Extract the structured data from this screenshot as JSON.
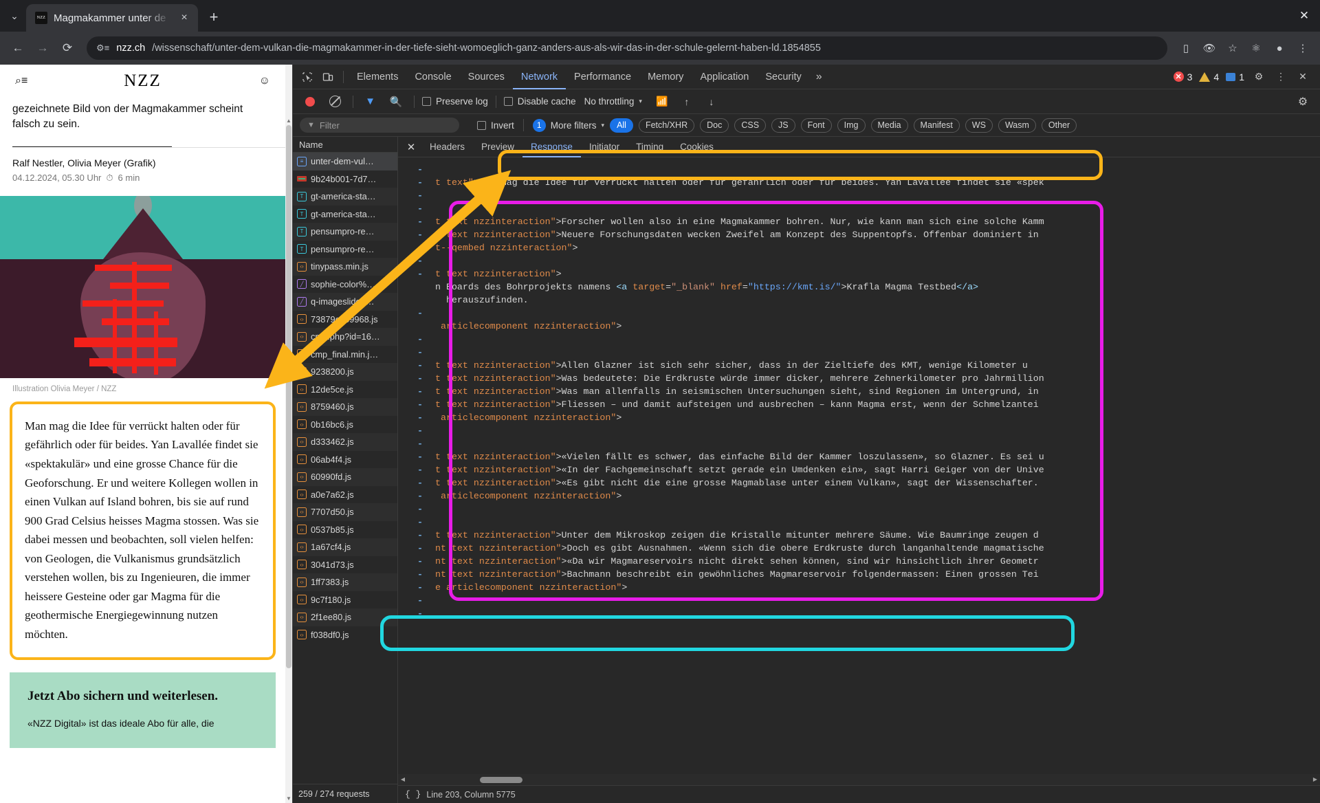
{
  "browser": {
    "tab": {
      "title": "Magmakammer unter de",
      "favicon_text": "NZZ"
    },
    "newtab_label": "+",
    "close_label": "×",
    "window_close": "✕",
    "url_host": "nzz.ch",
    "url_path": "/wissenschaft/unter-dem-vulkan-die-magmakammer-in-der-tiefe-sieht-womoeglich-ganz-anders-aus-als-wir-das-in-der-schule-gelernt-haben-ld.1854855",
    "nav": {
      "back": "←",
      "forward": "→",
      "reload": "⟳"
    },
    "toolbar_icons": [
      "cast-icon",
      "incognito-eye-icon",
      "bookmark-star-icon",
      "extensions-icon",
      "profile-icon",
      "menu-icon"
    ]
  },
  "page": {
    "logo": "NZZ",
    "lede": "gezeichnete Bild von der Magmakammer scheint falsch zu sein.",
    "byline": "Ralf Nestler, Olivia Meyer (Grafik)",
    "date": "04.12.2024, 05.30 Uhr",
    "reading_time": "6 min",
    "illustration_caption": "Illustration Olivia Meyer / NZZ",
    "highlighted_paragraph": "Man mag die Idee für verrückt halten oder für gefährlich oder für beides. Yan Lavallée findet sie «spektakulär» und eine grosse Chance für die Geoforschung. Er und weitere Kollegen wollen in einen Vulkan auf Island bohren, bis sie auf rund 900 Grad Celsius heisses Magma stossen. Was sie dabei messen und beobachten, soll vielen helfen: von Geologen, die Vulkanismus grundsätzlich verstehen wollen, bis zu Ingenieuren, die immer heissere Gesteine oder gar Magma für die geothermische Energiegewinnung nutzen möchten.",
    "abo": {
      "title": "Jetzt Abo sichern und weiterlesen.",
      "body": "«NZZ Digital» ist das ideale Abo für alle, die"
    }
  },
  "devtools": {
    "panels": [
      "Elements",
      "Console",
      "Sources",
      "Network",
      "Performance",
      "Memory",
      "Application",
      "Security"
    ],
    "selected_panel": "Network",
    "more_panels": "»",
    "counters": {
      "errors": "3",
      "warnings": "4",
      "messages": "1"
    },
    "settings_icon": "gear-icon",
    "kebab_icon": "kebab-icon",
    "close_icon": "✕",
    "controls": {
      "preserve_log": "Preserve log",
      "disable_cache": "Disable cache",
      "throttling": "No throttling",
      "caret": "▾"
    },
    "filter": {
      "placeholder": "Filter",
      "invert": "Invert",
      "more_filters": "More filters",
      "more_filters_count": "1",
      "caret": "▾",
      "types": [
        "All",
        "Fetch/XHR",
        "Doc",
        "CSS",
        "JS",
        "Font",
        "Img",
        "Media",
        "Manifest",
        "WS",
        "Wasm",
        "Other"
      ],
      "selected_type": "All"
    },
    "netlist": {
      "column": "Name",
      "status": "259 / 274 requests",
      "rows": [
        {
          "name": "unter-dem-vul…",
          "type": "doc",
          "glyph": "≡",
          "selected": true
        },
        {
          "name": "9b24b001-7d7…",
          "type": "media",
          "glyph": ""
        },
        {
          "name": "gt-america-sta…",
          "type": "font",
          "glyph": "T"
        },
        {
          "name": "gt-america-sta…",
          "type": "font",
          "glyph": "T"
        },
        {
          "name": "pensumpro-re…",
          "type": "font",
          "glyph": "T"
        },
        {
          "name": "pensumpro-re…",
          "type": "font",
          "glyph": "T"
        },
        {
          "name": "tinypass.min.js",
          "type": "js",
          "glyph": "‹›"
        },
        {
          "name": "sophie-color%…",
          "type": "img",
          "glyph": "╱"
        },
        {
          "name": "q-imageslide–…",
          "type": "img",
          "glyph": "╱"
        },
        {
          "name": "73879c159968.js",
          "type": "js",
          "glyph": "‹›"
        },
        {
          "name": "cmp.php?id=16…",
          "type": "js",
          "glyph": "‹›"
        },
        {
          "name": "cmp_final.min.j…",
          "type": "js",
          "glyph": "‹›"
        },
        {
          "name": "9238200.js",
          "type": "js",
          "glyph": "‹›"
        },
        {
          "name": "12de5ce.js",
          "type": "js",
          "glyph": "‹›"
        },
        {
          "name": "8759460.js",
          "type": "js",
          "glyph": "‹›"
        },
        {
          "name": "0b16bc6.js",
          "type": "js",
          "glyph": "‹›"
        },
        {
          "name": "d333462.js",
          "type": "js",
          "glyph": "‹›"
        },
        {
          "name": "06ab4f4.js",
          "type": "js",
          "glyph": "‹›"
        },
        {
          "name": "60990fd.js",
          "type": "js",
          "glyph": "‹›"
        },
        {
          "name": "a0e7a62.js",
          "type": "js",
          "glyph": "‹›"
        },
        {
          "name": "7707d50.js",
          "type": "js",
          "glyph": "‹›"
        },
        {
          "name": "0537b85.js",
          "type": "js",
          "glyph": "‹›"
        },
        {
          "name": "1a67cf4.js",
          "type": "js",
          "glyph": "‹›"
        },
        {
          "name": "3041d73.js",
          "type": "js",
          "glyph": "‹›"
        },
        {
          "name": "1ff7383.js",
          "type": "js",
          "glyph": "‹›"
        },
        {
          "name": "9c7f180.js",
          "type": "js",
          "glyph": "‹›"
        },
        {
          "name": "2f1ee80.js",
          "type": "js",
          "glyph": "‹›"
        },
        {
          "name": "f038df0.js",
          "type": "js",
          "glyph": "‹›"
        }
      ]
    },
    "resp_tabs": [
      "Headers",
      "Preview",
      "Response",
      "Initiator",
      "Timing",
      "Cookies"
    ],
    "resp_selected": "Response",
    "status_line": "Line 203, Column 5775",
    "code_lines": [
      {
        "fold": "-",
        "segs": []
      },
      {
        "fold": "-",
        "segs": [
          {
            "t": "t text\"",
            "c": "attr"
          },
          {
            "t": ">Man mag die Idee für verrückt halten oder für gefährlich oder für beides. Yan Lavallée findet sie «spek",
            "c": "plain"
          }
        ]
      },
      {
        "fold": "-",
        "segs": []
      },
      {
        "fold": "-",
        "segs": []
      },
      {
        "fold": "-",
        "segs": [
          {
            "t": "t text nzzinteraction\"",
            "c": "attr"
          },
          {
            "t": ">Forscher wollen also in eine Magmakammer bohren. Nur, wie kann man sich eine solche Kamm",
            "c": "plain"
          }
        ]
      },
      {
        "fold": "-",
        "segs": [
          {
            "t": "t text nzzinteraction\"",
            "c": "attr"
          },
          {
            "t": ">Neuere Forschungsdaten wecken Zweifel am Konzept des Suppentopfs. Offenbar dominiert in",
            "c": "plain"
          }
        ]
      },
      {
        "fold": "",
        "segs": [
          {
            "t": "t--qembed nzzinteraction\"",
            "c": "attr"
          },
          {
            "t": ">",
            "c": "plain"
          }
        ]
      },
      {
        "fold": "-",
        "segs": []
      },
      {
        "fold": "-",
        "segs": [
          {
            "t": "t text nzzinteraction\"",
            "c": "attr"
          },
          {
            "t": ">",
            "c": "plain"
          }
        ]
      },
      {
        "fold": "",
        "segs": [
          {
            "t": "n Boards des Bohrprojekts namens ",
            "c": "plain"
          },
          {
            "t": "<a",
            "c": "tagn"
          },
          {
            "t": " target",
            "c": "attr"
          },
          {
            "t": "=",
            "c": "plain"
          },
          {
            "t": "\"_blank\"",
            "c": "aval"
          },
          {
            "t": " href",
            "c": "attr"
          },
          {
            "t": "=",
            "c": "plain"
          },
          {
            "t": "\"https://kmt.is/\"",
            "c": "lnk"
          },
          {
            "t": ">Krafla Magma Testbed",
            "c": "plain"
          },
          {
            "t": "</a>",
            "c": "tagn"
          }
        ]
      },
      {
        "fold": "",
        "segs": [
          {
            "t": "  herauszufinden.",
            "c": "plain"
          }
        ]
      },
      {
        "fold": "-",
        "segs": []
      },
      {
        "fold": "",
        "segs": [
          {
            "t": " articlecomponent nzzinteraction\"",
            "c": "attr"
          },
          {
            "t": ">",
            "c": "plain"
          }
        ]
      },
      {
        "fold": "-",
        "segs": []
      },
      {
        "fold": "-",
        "segs": []
      },
      {
        "fold": "-",
        "segs": [
          {
            "t": "t text nzzinteraction\"",
            "c": "attr"
          },
          {
            "t": ">Allen Glazner ist sich sehr sicher, dass in der Zieltiefe des KMT, wenige Kilometer u",
            "c": "plain"
          }
        ]
      },
      {
        "fold": "-",
        "segs": [
          {
            "t": "t text nzzinteraction\"",
            "c": "attr"
          },
          {
            "t": ">Was bedeutete: Die Erdkruste würde immer dicker, mehrere Zehnerkilometer pro Jahrmillion",
            "c": "plain"
          }
        ]
      },
      {
        "fold": "-",
        "segs": [
          {
            "t": "t text nzzinteraction\"",
            "c": "attr"
          },
          {
            "t": ">Was man allenfalls in seismischen Untersuchungen sieht, sind Regionen im Untergrund, in",
            "c": "plain"
          }
        ]
      },
      {
        "fold": "-",
        "segs": [
          {
            "t": "t text nzzinteraction\"",
            "c": "attr"
          },
          {
            "t": ">Fliessen – und damit aufsteigen und ausbrechen – kann Magma erst, wenn der Schmelzantei",
            "c": "plain"
          }
        ]
      },
      {
        "fold": "-",
        "segs": [
          {
            "t": " articlecomponent nzzinteraction\"",
            "c": "attr"
          },
          {
            "t": ">",
            "c": "plain"
          }
        ]
      },
      {
        "fold": "-",
        "segs": []
      },
      {
        "fold": "-",
        "segs": []
      },
      {
        "fold": "-",
        "segs": [
          {
            "t": "t text nzzinteraction\"",
            "c": "attr"
          },
          {
            "t": ">«Vielen fällt es schwer, das einfache Bild der Kammer loszulassen», so Glazner. Es sei u",
            "c": "plain"
          }
        ]
      },
      {
        "fold": "-",
        "segs": [
          {
            "t": "t text nzzinteraction\"",
            "c": "attr"
          },
          {
            "t": ">«In der Fachgemeinschaft setzt gerade ein Umdenken ein», sagt Harri Geiger von der Unive",
            "c": "plain"
          }
        ]
      },
      {
        "fold": "-",
        "segs": [
          {
            "t": "t text nzzinteraction\"",
            "c": "attr"
          },
          {
            "t": ">«Es gibt nicht die eine grosse Magmablase unter einem Vulkan», sagt der Wissenschafter.",
            "c": "plain"
          }
        ]
      },
      {
        "fold": "-",
        "segs": [
          {
            "t": " articlecomponent nzzinteraction\"",
            "c": "attr"
          },
          {
            "t": ">",
            "c": "plain"
          }
        ]
      },
      {
        "fold": "-",
        "segs": []
      },
      {
        "fold": "-",
        "segs": []
      },
      {
        "fold": "-",
        "segs": [
          {
            "t": "t text nzzinteraction\"",
            "c": "attr"
          },
          {
            "t": ">Unter dem Mikroskop zeigen die Kristalle mitunter mehrere Säume. Wie Baumringe zeugen d",
            "c": "plain"
          }
        ]
      },
      {
        "fold": "-",
        "segs": [
          {
            "t": "nt text nzzinteraction\"",
            "c": "attr"
          },
          {
            "t": ">Doch es gibt Ausnahmen. «Wenn sich die obere Erdkruste durch langanhaltende magmatische",
            "c": "plain"
          }
        ]
      },
      {
        "fold": "-",
        "segs": [
          {
            "t": "nt text nzzinteraction\"",
            "c": "attr"
          },
          {
            "t": ">«Da wir Magmareservoirs nicht direkt sehen können, sind wir hinsichtlich ihrer Geometr",
            "c": "plain"
          }
        ]
      },
      {
        "fold": "-",
        "segs": [
          {
            "t": "nt text nzzinteraction\"",
            "c": "attr"
          },
          {
            "t": ">Bachmann beschreibt ein gewöhnliches Magmareservoir folgendermassen: Einen grossen Tei",
            "c": "plain"
          }
        ]
      },
      {
        "fold": "-",
        "segs": [
          {
            "t": "e articlecomponent nzzinteraction\"",
            "c": "attr"
          },
          {
            "t": ">",
            "c": "plain"
          }
        ]
      },
      {
        "fold": "-",
        "segs": []
      },
      {
        "fold": "-",
        "segs": []
      }
    ]
  },
  "annotations": {
    "orange_color": "#FBB419",
    "magenta_color": "#E81CE8",
    "cyan_color": "#21D7E0"
  }
}
